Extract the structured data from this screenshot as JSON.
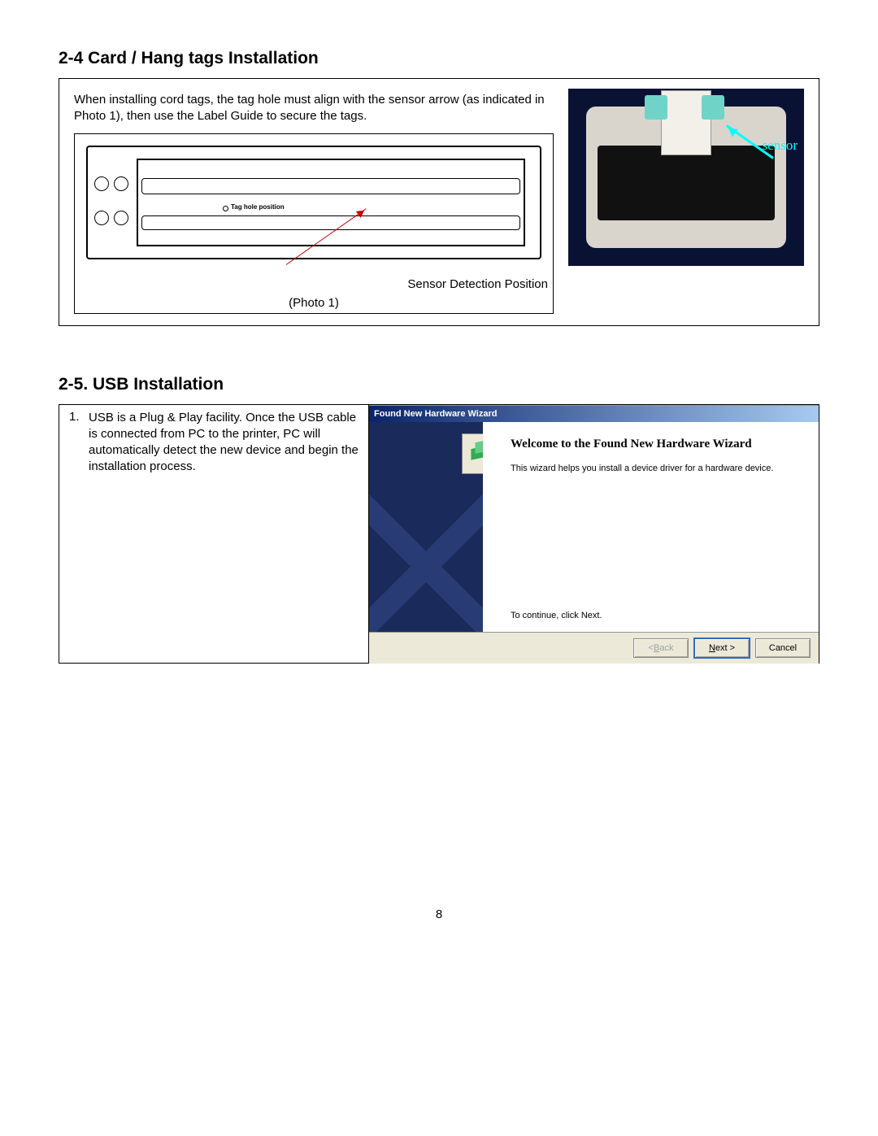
{
  "section1": {
    "heading": "2-4 Card / Hang tags Installation",
    "intro": "When installing cord tags, the tag hole must align with the sensor arrow (as indicated in Photo 1), then use the Label Guide to secure the tags.",
    "diagram": {
      "tag_hole_label": "Tag hole position",
      "caption": "Sensor Detection Position",
      "photo_label": "(Photo 1)"
    },
    "photo": {
      "sensor_label": "sensor"
    }
  },
  "section2": {
    "heading": "2-5. USB Installation",
    "step_num": "1.",
    "step_text": "USB is a Plug & Play facility.    Once the USB cable is connected from PC to the printer, PC will automatically detect the new device and begin the installation process.",
    "wizard": {
      "title": "Found New Hardware Wizard",
      "welcome": "Welcome to the Found New Hardware Wizard",
      "desc": "This wizard helps you install a device driver for a hardware device.",
      "continue": "To continue, click Next.",
      "btn_back": "< Back",
      "btn_next": "Next >",
      "btn_cancel": "Cancel"
    }
  },
  "page_number": "8"
}
